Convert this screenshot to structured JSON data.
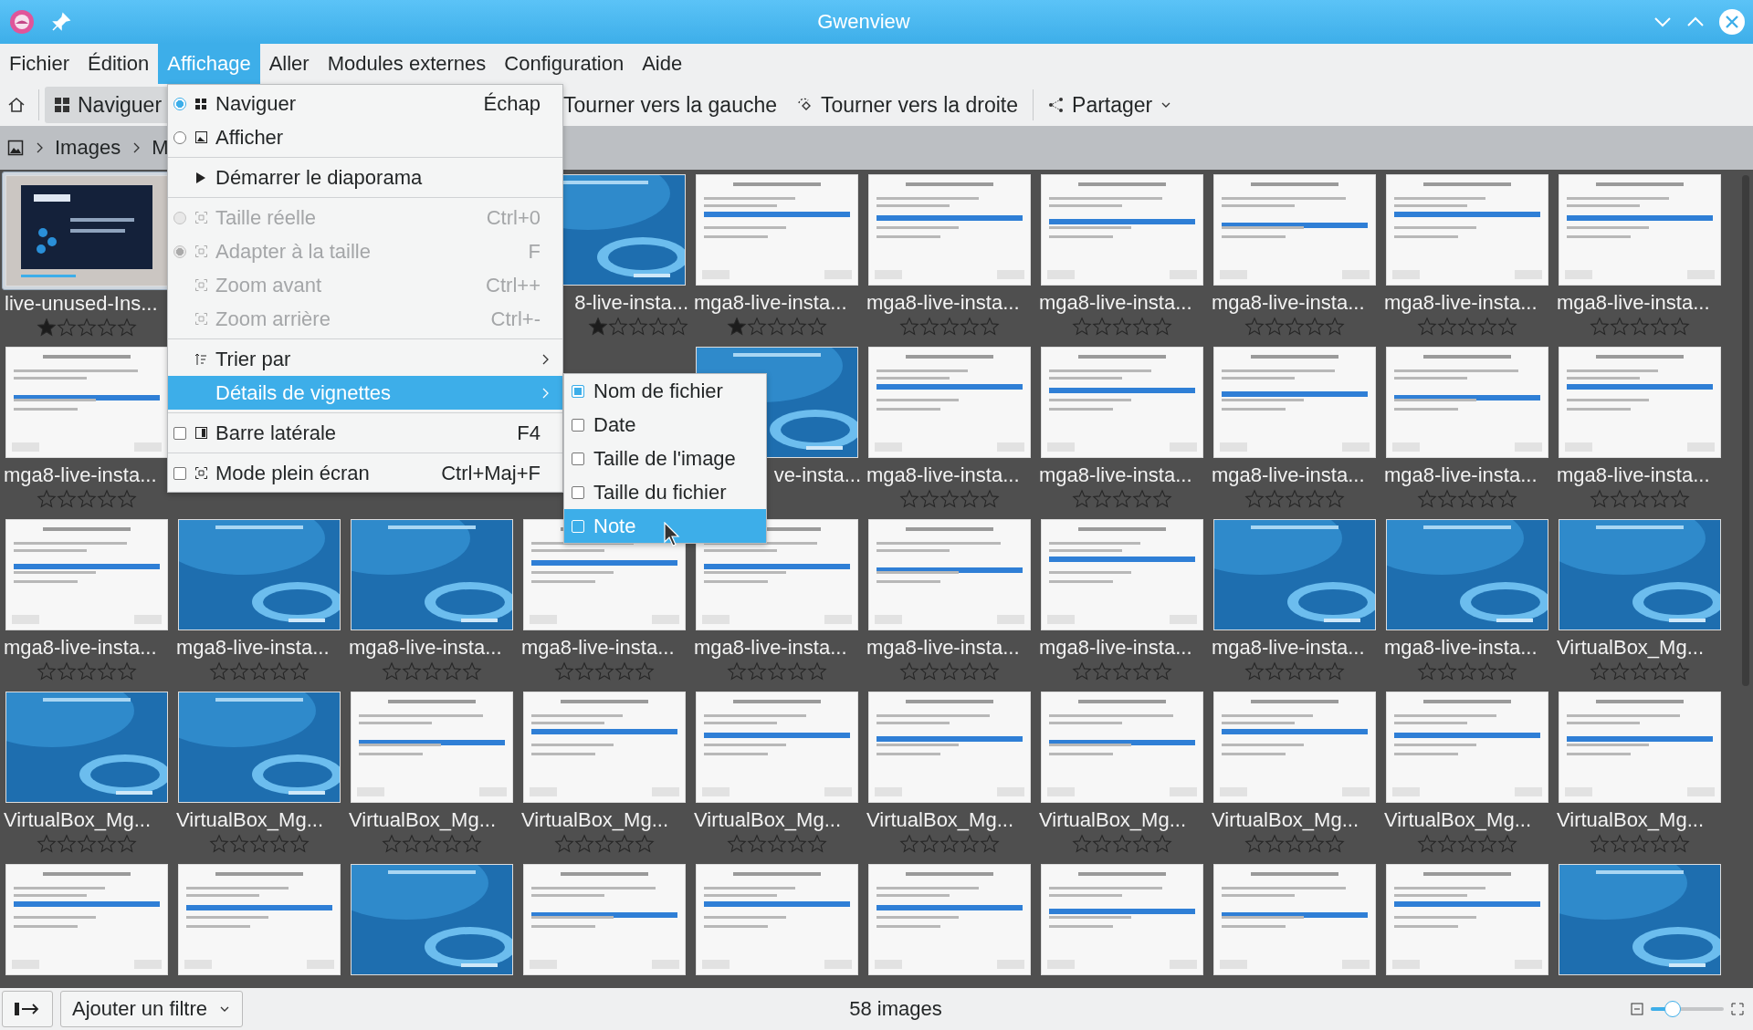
{
  "window": {
    "title": "Gwenview"
  },
  "menubar": [
    {
      "label": "Fichier",
      "selected": false
    },
    {
      "label": "Édition",
      "selected": false
    },
    {
      "label": "Affichage",
      "selected": true
    },
    {
      "label": "Aller",
      "selected": false
    },
    {
      "label": "Modules externes",
      "selected": false
    },
    {
      "label": "Configuration",
      "selected": false
    },
    {
      "label": "Aide",
      "selected": false
    }
  ],
  "toolbar": {
    "browse": {
      "label": "Naviguer",
      "selected": true
    },
    "rotate_left": "Tourner vers la gauche",
    "rotate_right": "Tourner vers la droite",
    "share": "Partager"
  },
  "breadcrumb": [
    "Images",
    "M"
  ],
  "menu": [
    {
      "kind": "radio",
      "label": "Naviguer",
      "shortcut": "Échap",
      "checked": true,
      "disabled": false,
      "selected": false
    },
    {
      "kind": "radio",
      "label": "Afficher",
      "checked": false,
      "disabled": false,
      "selected": false
    },
    {
      "kind": "separator"
    },
    {
      "kind": "action",
      "label": "Démarrer le diaporama",
      "disabled": false,
      "selected": false
    },
    {
      "kind": "separator"
    },
    {
      "kind": "radio",
      "label": "Taille réelle",
      "shortcut": "Ctrl+0",
      "checked": false,
      "disabled": true,
      "selected": false
    },
    {
      "kind": "radio",
      "label": "Adapter à la taille",
      "shortcut": "F",
      "checked": true,
      "disabled": true,
      "selected": false
    },
    {
      "kind": "action",
      "label": "Zoom avant",
      "shortcut": "Ctrl++",
      "disabled": true,
      "selected": false
    },
    {
      "kind": "action",
      "label": "Zoom arrière",
      "shortcut": "Ctrl+-",
      "disabled": true,
      "selected": false
    },
    {
      "kind": "separator"
    },
    {
      "kind": "submenu",
      "label": "Trier par",
      "disabled": false,
      "selected": false
    },
    {
      "kind": "submenu",
      "label": "Détails de vignettes",
      "disabled": false,
      "selected": true
    },
    {
      "kind": "separator"
    },
    {
      "kind": "checkbox",
      "label": "Barre latérale",
      "shortcut": "F4",
      "checked": false,
      "disabled": false,
      "selected": false
    },
    {
      "kind": "separator"
    },
    {
      "kind": "checkbox",
      "label": "Mode plein écran",
      "shortcut": "Ctrl+Maj+F",
      "checked": false,
      "disabled": false,
      "selected": false
    }
  ],
  "submenu": [
    {
      "label": "Nom de fichier",
      "checked": true,
      "selected": false
    },
    {
      "label": "Date",
      "checked": false,
      "selected": false
    },
    {
      "label": "Taille de l'image",
      "checked": false,
      "selected": false
    },
    {
      "label": "Taille du fichier",
      "checked": false,
      "selected": false
    },
    {
      "label": "Note",
      "checked": false,
      "selected": true
    }
  ],
  "grid": {
    "rows": [
      {
        "cells": [
          {
            "kind": "thumbnail",
            "label": "live-unused-Ins...",
            "stars": 1,
            "selected": true
          },
          {
            "kind": "covered"
          },
          {
            "kind": "covered"
          },
          {
            "kind": "thumbnail",
            "label": "8-live-insta...",
            "cut_left": true,
            "stars": 1,
            "selected": false
          },
          {
            "kind": "thumbnail",
            "label": "mga8-live-insta...",
            "stars": 1,
            "selected": false
          },
          {
            "kind": "thumbnail",
            "label": "mga8-live-insta...",
            "stars": 0,
            "selected": false
          },
          {
            "kind": "thumbnail",
            "label": "mga8-live-insta...",
            "stars": 0,
            "selected": false
          },
          {
            "kind": "thumbnail",
            "label": "mga8-live-insta...",
            "stars": 0,
            "selected": false
          },
          {
            "kind": "thumbnail",
            "label": "mga8-live-insta...",
            "stars": 0,
            "selected": false
          },
          {
            "kind": "thumbnail",
            "label": "mga8-live-insta...",
            "stars": 0,
            "selected": false
          }
        ]
      },
      {
        "cells": [
          {
            "kind": "thumbnail",
            "label": "mga8-live-insta...",
            "stars": 0,
            "selected": false
          },
          {
            "kind": "covered"
          },
          {
            "kind": "covered"
          },
          {
            "kind": "covered"
          },
          {
            "kind": "thumbnail",
            "label": "ve-insta...",
            "cut_left": true,
            "selected": false
          },
          {
            "kind": "thumbnail",
            "label": "mga8-live-insta...",
            "stars": 0,
            "selected": false
          },
          {
            "kind": "thumbnail",
            "label": "mga8-live-insta...",
            "stars": 0,
            "selected": false
          },
          {
            "kind": "thumbnail",
            "label": "mga8-live-insta...",
            "stars": 0,
            "selected": false
          },
          {
            "kind": "thumbnail",
            "label": "mga8-live-insta...",
            "stars": 0,
            "selected": false
          },
          {
            "kind": "thumbnail",
            "label": "mga8-live-insta...",
            "stars": 0,
            "selected": false
          }
        ]
      },
      {
        "cells": [
          {
            "kind": "thumbnail",
            "label": "mga8-live-insta...",
            "stars": 0,
            "selected": false
          },
          {
            "kind": "thumbnail",
            "label": "mga8-live-insta...",
            "stars": 0,
            "selected": false
          },
          {
            "kind": "thumbnail",
            "label": "mga8-live-insta...",
            "stars": 0,
            "selected": false
          },
          {
            "kind": "thumbnail",
            "label": "mga8-live-insta...",
            "stars": 0,
            "selected": false
          },
          {
            "kind": "thumbnail",
            "label": "mga8-live-insta...",
            "stars": 0,
            "selected": false
          },
          {
            "kind": "thumbnail",
            "label": "mga8-live-insta...",
            "stars": 0,
            "selected": false
          },
          {
            "kind": "thumbnail",
            "label": "mga8-live-insta...",
            "stars": 0,
            "selected": false
          },
          {
            "kind": "thumbnail",
            "label": "mga8-live-insta...",
            "stars": 0,
            "selected": false
          },
          {
            "kind": "thumbnail",
            "label": "mga8-live-insta...",
            "stars": 0,
            "selected": false
          },
          {
            "kind": "thumbnail",
            "label": "VirtualBox_Mg...",
            "stars": 0,
            "selected": false
          }
        ]
      },
      {
        "cells": [
          {
            "kind": "thumbnail",
            "label": "VirtualBox_Mg...",
            "stars": 0,
            "selected": false
          },
          {
            "kind": "thumbnail",
            "label": "VirtualBox_Mg...",
            "stars": 0,
            "selected": false
          },
          {
            "kind": "thumbnail",
            "label": "VirtualBox_Mg...",
            "stars": 0,
            "selected": false
          },
          {
            "kind": "thumbnail",
            "label": "VirtualBox_Mg...",
            "stars": 0,
            "selected": false
          },
          {
            "kind": "thumbnail",
            "label": "VirtualBox_Mg...",
            "stars": 0,
            "selected": false
          },
          {
            "kind": "thumbnail",
            "label": "VirtualBox_Mg...",
            "stars": 0,
            "selected": false
          },
          {
            "kind": "thumbnail",
            "label": "VirtualBox_Mg...",
            "stars": 0,
            "selected": false
          },
          {
            "kind": "thumbnail",
            "label": "VirtualBox_Mg...",
            "stars": 0,
            "selected": false
          },
          {
            "kind": "thumbnail",
            "label": "VirtualBox_Mg...",
            "stars": 0,
            "selected": false
          },
          {
            "kind": "thumbnail",
            "label": "VirtualBox_Mg...",
            "stars": 0,
            "selected": false
          }
        ]
      },
      {
        "cells": [
          {
            "kind": "thumbnail",
            "selected": false
          },
          {
            "kind": "thumbnail",
            "selected": false
          },
          {
            "kind": "thumbnail",
            "selected": false
          },
          {
            "kind": "thumbnail",
            "selected": false
          },
          {
            "kind": "thumbnail",
            "selected": false
          },
          {
            "kind": "thumbnail",
            "selected": false
          },
          {
            "kind": "thumbnail",
            "selected": false
          },
          {
            "kind": "thumbnail",
            "selected": false
          },
          {
            "kind": "thumbnail",
            "selected": false
          },
          {
            "kind": "thumbnail",
            "selected": false
          }
        ]
      }
    ]
  },
  "status_bar": {
    "filter": "Ajouter un filtre",
    "count": "58 images",
    "zoom": {
      "level": 0.3
    }
  }
}
